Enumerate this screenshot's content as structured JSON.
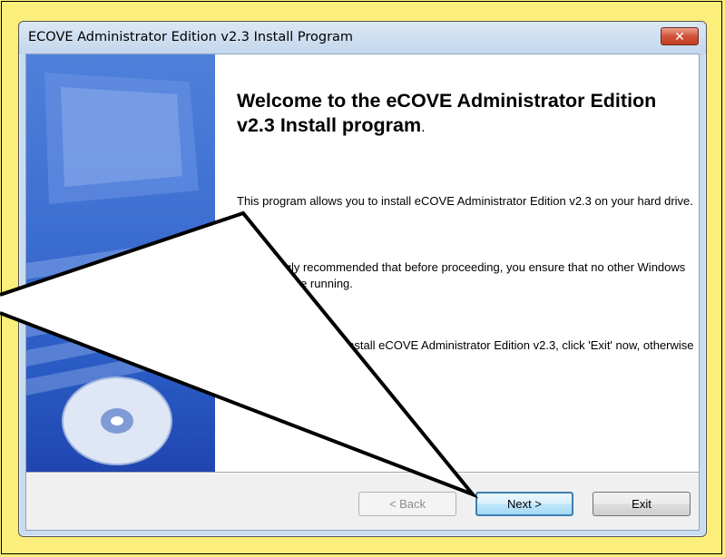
{
  "window": {
    "title": "ECOVE Administrator Edition v2.3 Install Program",
    "close_glyph": "✕"
  },
  "welcome": {
    "heading": "Welcome to the eCOVE Administrator Edition v2.3 Install program",
    "heading_period": ".",
    "paragraphs": [
      "This program allows you to install eCOVE Administrator Edition v2.3 on your hard drive.",
      "It is strongly recommended that before proceeding, you ensure that no other Windows programs are running.",
      "If you do not wish to install eCOVE Administrator Edition v2.3, click 'Exit' now, otherwise click 'Next' to continue."
    ]
  },
  "buttons": {
    "back": {
      "label": "< Back",
      "enabled": false
    },
    "next": {
      "label": "Next >",
      "enabled": true
    },
    "exit": {
      "label": "Exit",
      "enabled": true
    }
  },
  "colors": {
    "background": "#fcee7a",
    "side_panel": "#3e6fd2",
    "arrow": "#7ee04a"
  },
  "icons": {
    "side_panel": [
      "monitor-icon",
      "keyboard-icon",
      "up-arrow-icon",
      "cd-disc-icon"
    ],
    "annotation": "callout-pointer-icon"
  }
}
